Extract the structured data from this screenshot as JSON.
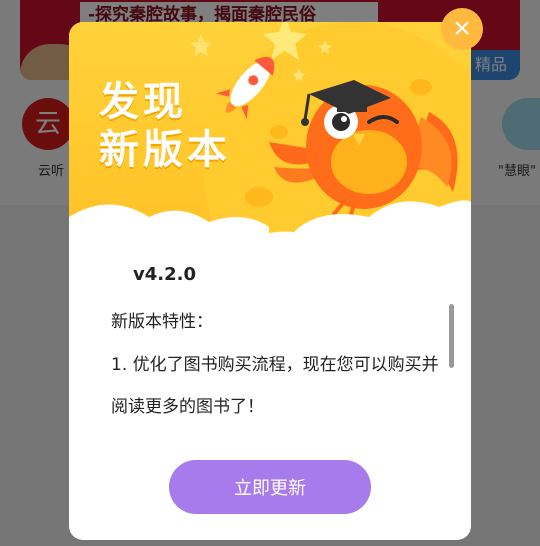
{
  "background": {
    "banner_text": "-探究秦腔故事，揭面秦腔民俗",
    "banner_tag": "精品",
    "left_icon_glyph": "云",
    "left_label": "云听",
    "right_label": "\"慧眼\""
  },
  "dialog": {
    "title_line1": "发现",
    "title_line2": "新版本",
    "version": "v4.2.0",
    "features_label": "新版本特性：",
    "feature_items": [
      "1. 优化了图书购买流程，现在您可以购买并阅读更多的图书了！"
    ],
    "update_button_label": "立即更新",
    "close_symbol": "×",
    "mascot": "owl-with-graduation-cap-icon",
    "decoration": "rocket-icon"
  },
  "colors": {
    "header_yellow": "#ffd23a",
    "header_orange": "#ffb21e",
    "button_purple": "#a77bec",
    "close_orange": "#ffb93e"
  }
}
